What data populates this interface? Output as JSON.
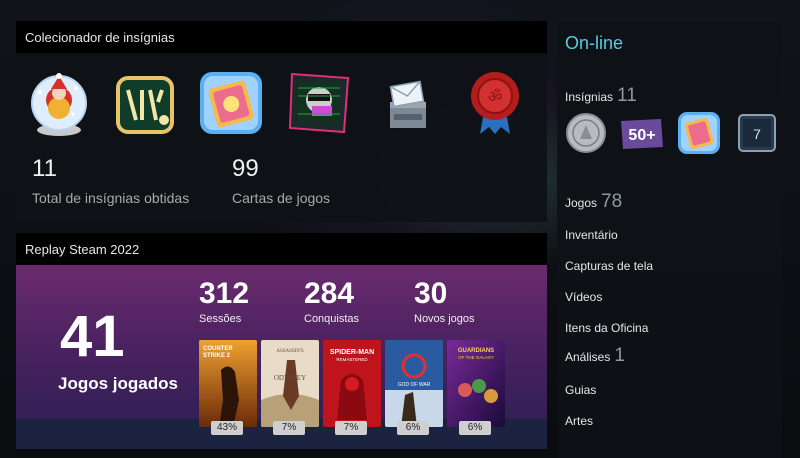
{
  "badge_collector": {
    "title": "Colecionador de insígnias",
    "total_badges": "11",
    "total_badges_label": "Total de insígnias obtidas",
    "game_cards": "99",
    "game_cards_label": "Cartas de jogos",
    "badges": [
      {
        "icon": "snow-globe-santa-badge-icon"
      },
      {
        "icon": "ornate-green-badge-icon"
      },
      {
        "icon": "steam-card-badge-icon"
      },
      {
        "icon": "glitch-portrait-badge-icon"
      },
      {
        "icon": "mail-box-badge-icon"
      },
      {
        "icon": "red-wax-seal-badge-icon"
      }
    ]
  },
  "replay": {
    "title": "Replay Steam 2022",
    "games_played": "41",
    "games_played_label": "Jogos jogados",
    "stats": [
      {
        "value": "312",
        "label": "Sessões"
      },
      {
        "value": "284",
        "label": "Conquistas"
      },
      {
        "value": "30",
        "label": "Novos jogos"
      }
    ],
    "games": [
      {
        "title": "Counter-Strike 2",
        "percent": "43%"
      },
      {
        "title": "Assassin's Creed Odyssey",
        "percent": "7%"
      },
      {
        "title": "Spider-Man Remastered",
        "percent": "7%"
      },
      {
        "title": "God of War",
        "percent": "6%"
      },
      {
        "title": "Guardians of the Galaxy",
        "percent": "6%"
      }
    ]
  },
  "sidebar": {
    "status": "On-line",
    "badges_label": "Insígnias",
    "badges_count": "11",
    "badge_icons": [
      "silver-coin-badge-icon",
      "level-50-plus-badge-icon",
      "steam-card-badge-icon",
      "number-7-badge-icon"
    ],
    "badge_50_text": "50+",
    "badge_7_text": "7",
    "games_label": "Jogos",
    "games_count": "78",
    "inventory": "Inventário",
    "screenshots": "Capturas de tela",
    "videos": "Vídeos",
    "workshop": "Itens da Oficina",
    "reviews_label": "Análises",
    "reviews_count": "1",
    "guides": "Guias",
    "artwork": "Artes"
  },
  "colors": {
    "online": "#57cbde",
    "replay_gradient_top": "#6a2b6e",
    "replay_gradient_bottom": "#2a1e52"
  }
}
